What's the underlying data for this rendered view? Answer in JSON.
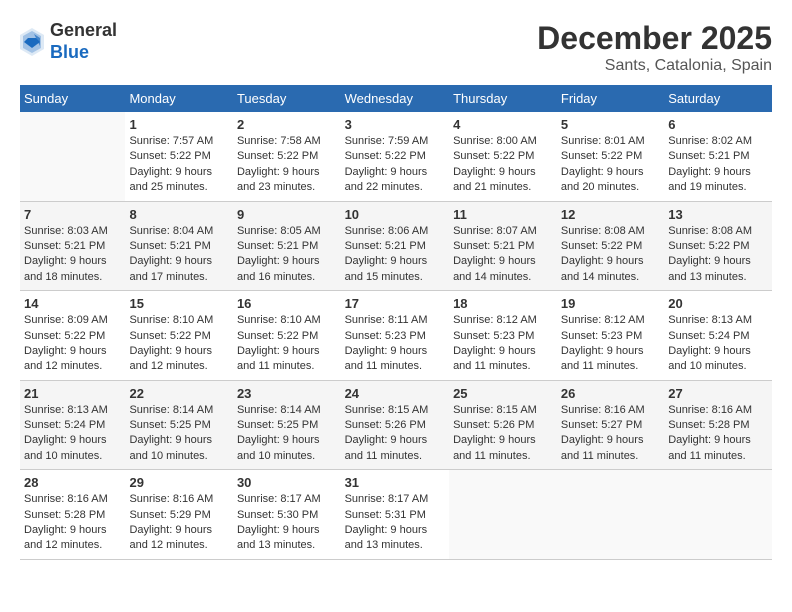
{
  "header": {
    "logo_line1": "General",
    "logo_line2": "Blue",
    "month_year": "December 2025",
    "location": "Sants, Catalonia, Spain"
  },
  "weekdays": [
    "Sunday",
    "Monday",
    "Tuesday",
    "Wednesday",
    "Thursday",
    "Friday",
    "Saturday"
  ],
  "weeks": [
    [
      {
        "day": "",
        "info": ""
      },
      {
        "day": "1",
        "info": "Sunrise: 7:57 AM\nSunset: 5:22 PM\nDaylight: 9 hours\nand 25 minutes."
      },
      {
        "day": "2",
        "info": "Sunrise: 7:58 AM\nSunset: 5:22 PM\nDaylight: 9 hours\nand 23 minutes."
      },
      {
        "day": "3",
        "info": "Sunrise: 7:59 AM\nSunset: 5:22 PM\nDaylight: 9 hours\nand 22 minutes."
      },
      {
        "day": "4",
        "info": "Sunrise: 8:00 AM\nSunset: 5:22 PM\nDaylight: 9 hours\nand 21 minutes."
      },
      {
        "day": "5",
        "info": "Sunrise: 8:01 AM\nSunset: 5:22 PM\nDaylight: 9 hours\nand 20 minutes."
      },
      {
        "day": "6",
        "info": "Sunrise: 8:02 AM\nSunset: 5:21 PM\nDaylight: 9 hours\nand 19 minutes."
      }
    ],
    [
      {
        "day": "7",
        "info": "Sunrise: 8:03 AM\nSunset: 5:21 PM\nDaylight: 9 hours\nand 18 minutes."
      },
      {
        "day": "8",
        "info": "Sunrise: 8:04 AM\nSunset: 5:21 PM\nDaylight: 9 hours\nand 17 minutes."
      },
      {
        "day": "9",
        "info": "Sunrise: 8:05 AM\nSunset: 5:21 PM\nDaylight: 9 hours\nand 16 minutes."
      },
      {
        "day": "10",
        "info": "Sunrise: 8:06 AM\nSunset: 5:21 PM\nDaylight: 9 hours\nand 15 minutes."
      },
      {
        "day": "11",
        "info": "Sunrise: 8:07 AM\nSunset: 5:21 PM\nDaylight: 9 hours\nand 14 minutes."
      },
      {
        "day": "12",
        "info": "Sunrise: 8:08 AM\nSunset: 5:22 PM\nDaylight: 9 hours\nand 14 minutes."
      },
      {
        "day": "13",
        "info": "Sunrise: 8:08 AM\nSunset: 5:22 PM\nDaylight: 9 hours\nand 13 minutes."
      }
    ],
    [
      {
        "day": "14",
        "info": "Sunrise: 8:09 AM\nSunset: 5:22 PM\nDaylight: 9 hours\nand 12 minutes."
      },
      {
        "day": "15",
        "info": "Sunrise: 8:10 AM\nSunset: 5:22 PM\nDaylight: 9 hours\nand 12 minutes."
      },
      {
        "day": "16",
        "info": "Sunrise: 8:10 AM\nSunset: 5:22 PM\nDaylight: 9 hours\nand 11 minutes."
      },
      {
        "day": "17",
        "info": "Sunrise: 8:11 AM\nSunset: 5:23 PM\nDaylight: 9 hours\nand 11 minutes."
      },
      {
        "day": "18",
        "info": "Sunrise: 8:12 AM\nSunset: 5:23 PM\nDaylight: 9 hours\nand 11 minutes."
      },
      {
        "day": "19",
        "info": "Sunrise: 8:12 AM\nSunset: 5:23 PM\nDaylight: 9 hours\nand 11 minutes."
      },
      {
        "day": "20",
        "info": "Sunrise: 8:13 AM\nSunset: 5:24 PM\nDaylight: 9 hours\nand 10 minutes."
      }
    ],
    [
      {
        "day": "21",
        "info": "Sunrise: 8:13 AM\nSunset: 5:24 PM\nDaylight: 9 hours\nand 10 minutes."
      },
      {
        "day": "22",
        "info": "Sunrise: 8:14 AM\nSunset: 5:25 PM\nDaylight: 9 hours\nand 10 minutes."
      },
      {
        "day": "23",
        "info": "Sunrise: 8:14 AM\nSunset: 5:25 PM\nDaylight: 9 hours\nand 10 minutes."
      },
      {
        "day": "24",
        "info": "Sunrise: 8:15 AM\nSunset: 5:26 PM\nDaylight: 9 hours\nand 11 minutes."
      },
      {
        "day": "25",
        "info": "Sunrise: 8:15 AM\nSunset: 5:26 PM\nDaylight: 9 hours\nand 11 minutes."
      },
      {
        "day": "26",
        "info": "Sunrise: 8:16 AM\nSunset: 5:27 PM\nDaylight: 9 hours\nand 11 minutes."
      },
      {
        "day": "27",
        "info": "Sunrise: 8:16 AM\nSunset: 5:28 PM\nDaylight: 9 hours\nand 11 minutes."
      }
    ],
    [
      {
        "day": "28",
        "info": "Sunrise: 8:16 AM\nSunset: 5:28 PM\nDaylight: 9 hours\nand 12 minutes."
      },
      {
        "day": "29",
        "info": "Sunrise: 8:16 AM\nSunset: 5:29 PM\nDaylight: 9 hours\nand 12 minutes."
      },
      {
        "day": "30",
        "info": "Sunrise: 8:17 AM\nSunset: 5:30 PM\nDaylight: 9 hours\nand 13 minutes."
      },
      {
        "day": "31",
        "info": "Sunrise: 8:17 AM\nSunset: 5:31 PM\nDaylight: 9 hours\nand 13 minutes."
      },
      {
        "day": "",
        "info": ""
      },
      {
        "day": "",
        "info": ""
      },
      {
        "day": "",
        "info": ""
      }
    ]
  ]
}
